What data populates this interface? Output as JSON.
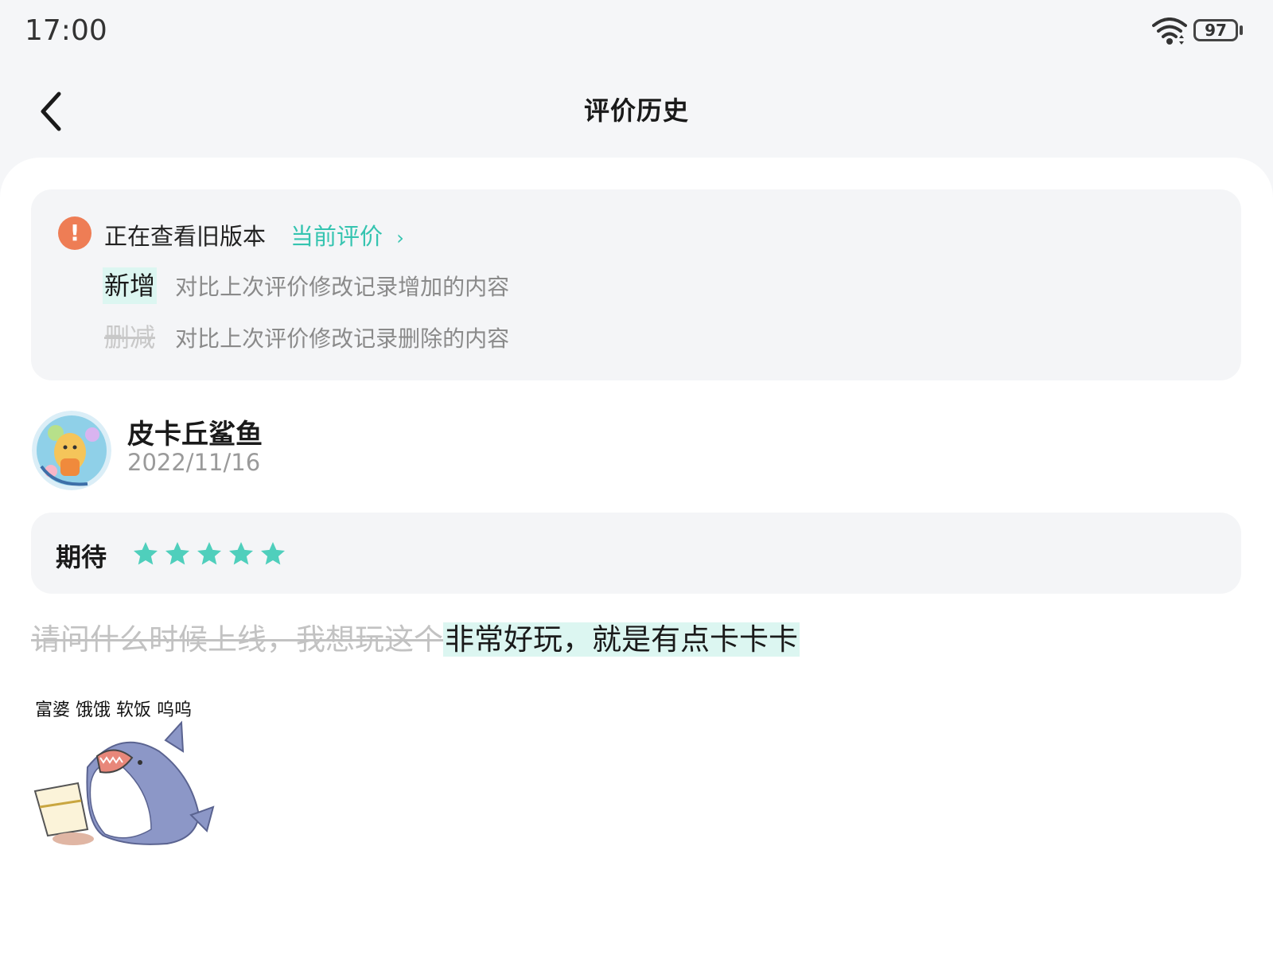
{
  "status_bar": {
    "time": "17:00",
    "battery": "97"
  },
  "header": {
    "title": "评价历史"
  },
  "notice": {
    "text": "正在查看旧版本",
    "link_label": "当前评价",
    "link_arrow": "›",
    "legend": {
      "added_tag": "新增",
      "added_desc": "对比上次评价修改记录增加的内容",
      "deleted_tag": "删减",
      "deleted_desc": "对比上次评价修改记录删除的内容"
    }
  },
  "review": {
    "user_name": "皮卡丘鲨鱼",
    "date": "2022/11/16",
    "rating_label": "期待",
    "rating": 5,
    "rating_max": 5,
    "deleted_text": "请问什么时候上线，我想玩这个",
    "added_text": "非常好玩，就是有点卡卡卡",
    "sticker_caption": "富婆 饿饿 软饭 呜呜"
  },
  "colors": {
    "accent": "#35c4b0",
    "star": "#4fcfbc",
    "warning": "#ee7d55",
    "added_bg": "#dcf6f1",
    "deleted_text": "#c2c2c2"
  }
}
